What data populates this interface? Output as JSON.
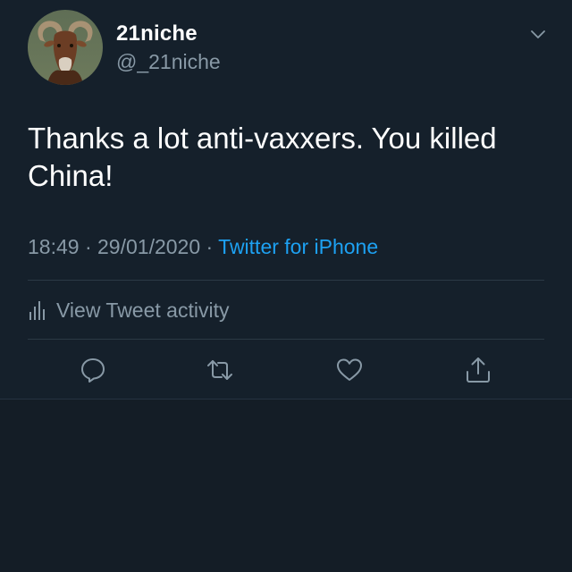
{
  "user": {
    "display_name": "21niche",
    "handle": "@_21niche",
    "avatar_icon": "mouflon-ram-avatar"
  },
  "tweet": {
    "text": "Thanks a lot anti-vaxxers. You killed China!",
    "time": "18:49",
    "separator": " · ",
    "date": "29/01/2020",
    "source": "Twitter for iPhone"
  },
  "activity": {
    "label": "View Tweet activity",
    "icon": "bar-chart-icon"
  },
  "actions": [
    {
      "name": "reply",
      "icon": "reply-icon"
    },
    {
      "name": "retweet",
      "icon": "retweet-icon"
    },
    {
      "name": "like",
      "icon": "heart-icon"
    },
    {
      "name": "share",
      "icon": "share-icon"
    }
  ],
  "colors": {
    "background": "#15202b",
    "text": "#ffffff",
    "secondary": "#8899a6",
    "accent": "#1da1f2"
  }
}
